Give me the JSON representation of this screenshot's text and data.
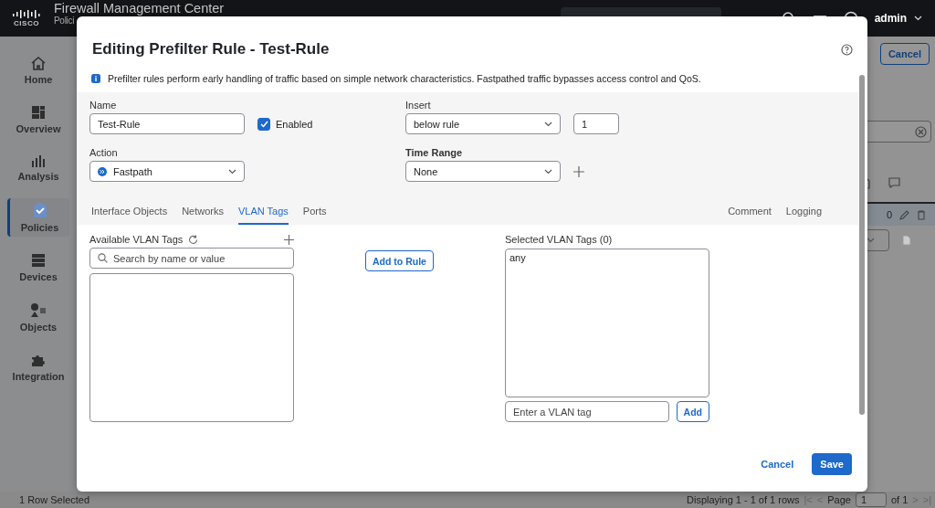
{
  "app": {
    "logo": "CISCO",
    "title": "Firewall Management Center",
    "subtitle": "Polici",
    "user": "admin"
  },
  "sidebar": {
    "items": [
      {
        "label": "Home",
        "selected": false
      },
      {
        "label": "Overview",
        "selected": false
      },
      {
        "label": "Analysis",
        "selected": false
      },
      {
        "label": "Policies",
        "selected": true
      },
      {
        "label": "Devices",
        "selected": false
      },
      {
        "label": "Objects",
        "selected": false
      },
      {
        "label": "Integration",
        "selected": false
      }
    ]
  },
  "background": {
    "cancel_button": "Cancel",
    "row_value": "0",
    "status": "1 Row Selected",
    "pager": {
      "summary": "Displaying 1 - 1 of 1 rows",
      "first": "|<",
      "previous": "<",
      "page_label": "Page",
      "page": "1",
      "total": "of 1",
      "next": ">",
      "last": ">|"
    }
  },
  "dialog": {
    "title": "Editing Prefilter Rule - Test-Rule",
    "info": "Prefilter rules perform early handling of traffic based on simple network characteristics. Fastpathed traffic bypasses access control and QoS.",
    "name": {
      "label": "Name",
      "value": "Test-Rule"
    },
    "enabled": {
      "label": "Enabled",
      "checked": true
    },
    "insert": {
      "label": "Insert",
      "value": "below rule",
      "number": "1"
    },
    "action": {
      "label": "Action",
      "value": "Fastpath"
    },
    "time_range": {
      "label": "Time Range",
      "value": "None"
    },
    "tabs": [
      {
        "label": "Interface Objects",
        "selected": false
      },
      {
        "label": "Networks",
        "selected": false
      },
      {
        "label": "VLAN Tags",
        "selected": true
      },
      {
        "label": "Ports",
        "selected": false
      }
    ],
    "side_tabs": [
      {
        "label": "Comment",
        "selected": false
      },
      {
        "label": "Logging",
        "selected": false
      }
    ],
    "available": {
      "label": "Available VLAN Tags",
      "placeholder": "Search by name or value"
    },
    "add_to_rule": "Add to Rule",
    "selected_tags": {
      "label": "Selected VLAN Tags (0)",
      "items": [
        "any"
      ],
      "placeholder": "Enter a VLAN tag",
      "add_button": "Add"
    },
    "buttons": {
      "cancel": "Cancel",
      "save": "Save"
    }
  }
}
